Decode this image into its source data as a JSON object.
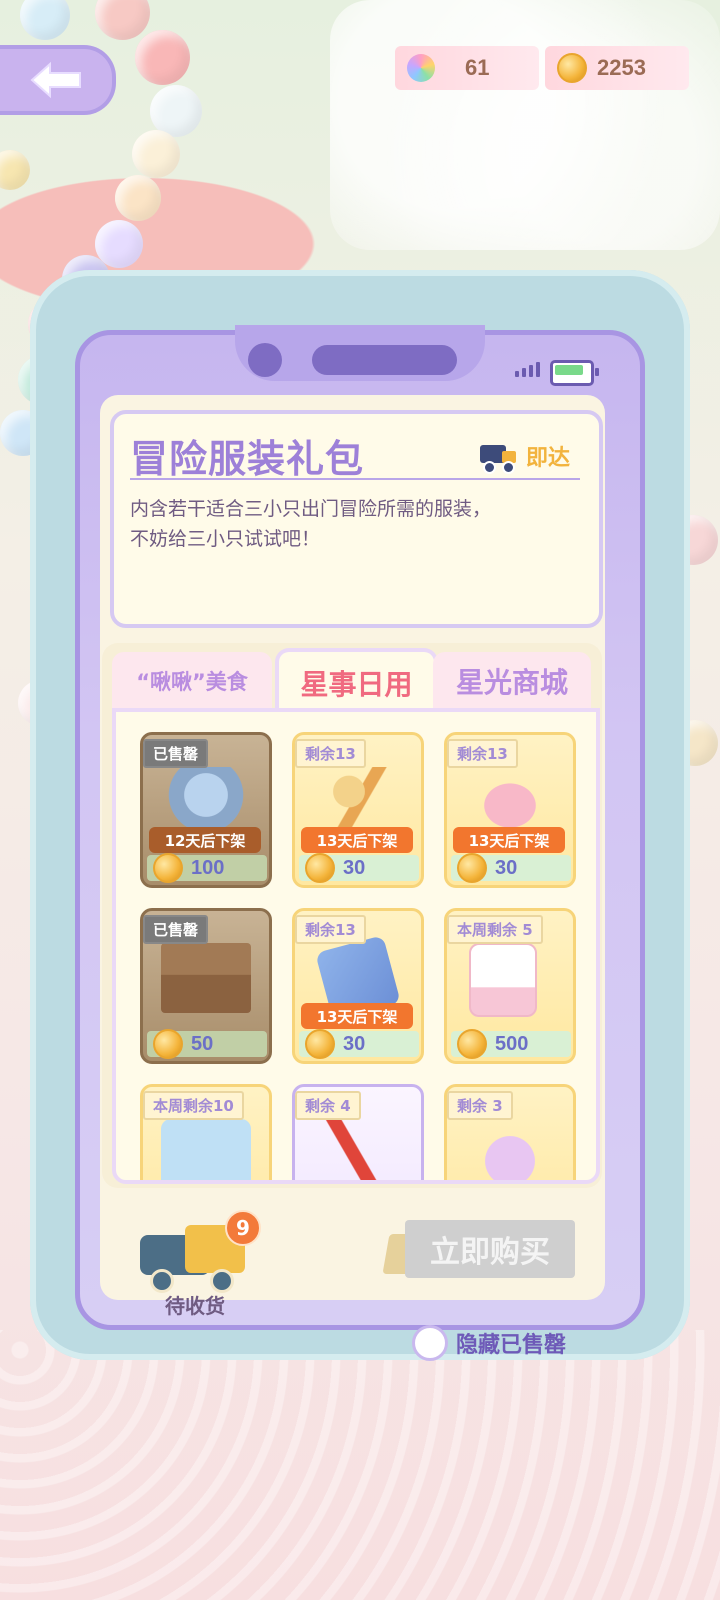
{
  "currency": {
    "gems": "61",
    "coins": "2253"
  },
  "header": {
    "back_icon": "arrow-left-icon"
  },
  "info": {
    "title": "冒险服装礼包",
    "delivery_label": "即达",
    "description_line1": "内含若干适合三小只出门冒险所需的服装，",
    "description_line2": "不妨给三小只试试吧！"
  },
  "tabs": [
    {
      "label": "“啾啾”美食",
      "active": false
    },
    {
      "label": "星事日用",
      "active": true
    },
    {
      "label": "星光商城",
      "active": false
    }
  ],
  "items": [
    {
      "tag": "已售罄",
      "expire": "12天后下架",
      "price": "100",
      "sold": true
    },
    {
      "tag": "剩余13",
      "expire": "13天后下架",
      "price": "30",
      "sold": false
    },
    {
      "tag": "剩余13",
      "expire": "13天后下架",
      "price": "30",
      "sold": false
    },
    {
      "tag": "已售罄",
      "expire": "",
      "price": "50",
      "sold": true
    },
    {
      "tag": "剩余13",
      "expire": "13天后下架",
      "price": "30",
      "sold": false
    },
    {
      "tag": "本周剩余 5",
      "expire": "",
      "price": "500",
      "sold": false
    },
    {
      "tag": "本周剩余10",
      "expire": "",
      "price": "",
      "sold": false
    },
    {
      "tag": "剩余 4",
      "expire": "",
      "price": "",
      "sold": false
    },
    {
      "tag": "剩余 3",
      "expire": "",
      "price": "",
      "sold": false
    }
  ],
  "delivery_truck": {
    "badge_count": "9",
    "label": "待收货"
  },
  "buy_button": "立即购买",
  "hide_sold_label": "隐藏已售罄",
  "colors": {
    "accent_purple": "#9d80d8",
    "active_tab": "#f06a80",
    "expire_orange": "#f2762e",
    "price_text": "#6b6fc7"
  }
}
